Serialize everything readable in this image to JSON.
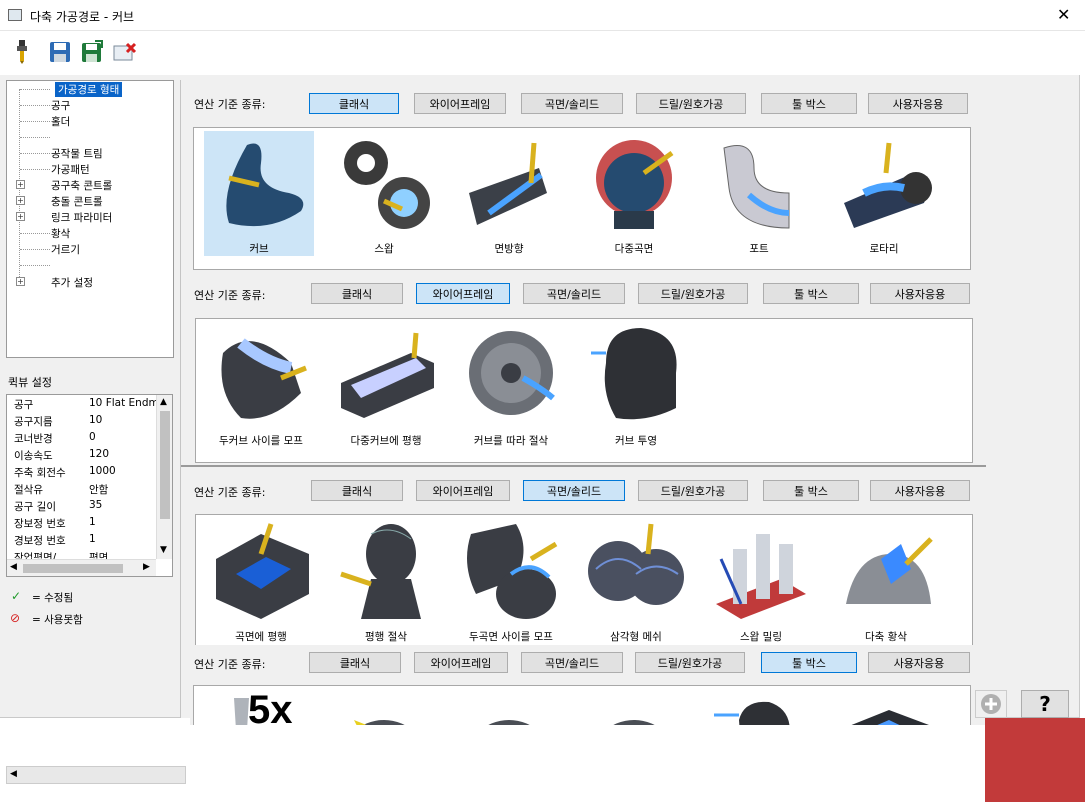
{
  "window": {
    "title": "다축 가공경로 - 커브",
    "close": "✕"
  },
  "toolbar": {
    "items": [
      "tool-icon",
      "save-icon",
      "save-as-icon",
      "delete-icon"
    ]
  },
  "tree": {
    "items": [
      "가공경로 형태",
      "공구",
      "홀더",
      "",
      "공작물 트림",
      "가공패턴",
      "공구축 콘트롤",
      "충돌 콘트롤",
      "링크 파라미터",
      "황삭",
      "거르기",
      "",
      "추가 설정"
    ]
  },
  "props": {
    "title": "퀵뷰 설정",
    "rows": [
      {
        "k": "공구",
        "v": "10 Flat Endmill"
      },
      {
        "k": "공구지름",
        "v": "10"
      },
      {
        "k": "코너반경",
        "v": "0"
      },
      {
        "k": "이송속도",
        "v": "120"
      },
      {
        "k": "주축 회전수",
        "v": "1000"
      },
      {
        "k": "절삭유",
        "v": "안함"
      },
      {
        "k": "공구 길이",
        "v": "35"
      },
      {
        "k": "장보정 번호",
        "v": "1"
      },
      {
        "k": "경보정 번호",
        "v": "1"
      },
      {
        "k": "작업평면/...",
        "v": "평면"
      }
    ]
  },
  "legend": {
    "modified": "= 수정됨",
    "disabled": "= 사용못함"
  },
  "category_label": "연산 기준 종류:",
  "tabs": [
    "클래식",
    "와이어프레임",
    "곡면/솔리드",
    "드릴/원호가공",
    "툴 박스",
    "사용자응용"
  ],
  "sections": [
    {
      "active": 0,
      "items": [
        "커브",
        "스왑",
        "면방향",
        "다중곡면",
        "포트",
        "로타리"
      ]
    },
    {
      "active": 1,
      "items": [
        "두커브 사이를 모프",
        "다중커브에 평행",
        "커브를 따라 절삭",
        "커브 투영"
      ]
    },
    {
      "active": 2,
      "items": [
        "곡면에 평행",
        "평행 절삭",
        "두곡면 사이를 모프",
        "삼각형 메쉬",
        "스왑 밀링",
        "다축 황삭"
      ]
    },
    {
      "active": 4,
      "items": [
        "",
        "",
        "",
        "",
        "",
        ""
      ]
    }
  ],
  "toolbox_badge": "5x",
  "help": "?",
  "colors": {
    "accent": "#0078d7",
    "selection": "#0a64c8",
    "highlight": "#cde5f7",
    "part": "#2a3a4a",
    "toolpath": "#2f6fd6",
    "tool": "#d9b21e"
  }
}
